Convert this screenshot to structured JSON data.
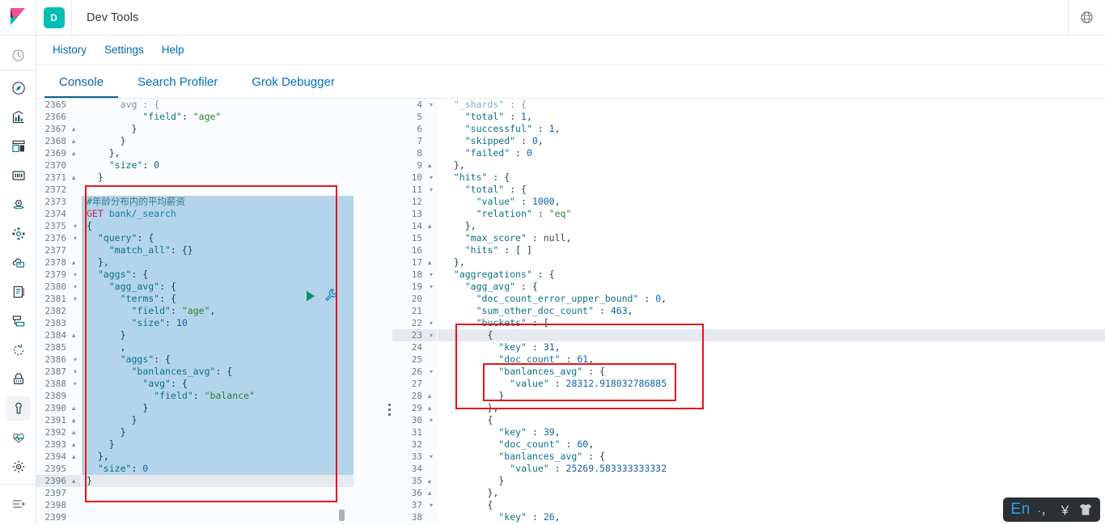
{
  "app": {
    "logo_icon": "kibana-logo",
    "badge_letter": "D",
    "title": "Dev Tools",
    "help_icon": "help-globe-icon"
  },
  "rail": {
    "top_items": [
      {
        "icon": "recently-viewed-clock-icon",
        "selected": false
      }
    ],
    "main_items": [
      {
        "icon": "discover-compass-icon",
        "selected": false
      },
      {
        "icon": "visualize-chart-icon",
        "selected": false
      },
      {
        "icon": "dashboard-grid-icon",
        "selected": false
      },
      {
        "icon": "canvas-presentation-icon",
        "selected": false
      },
      {
        "icon": "maps-globe-icon",
        "selected": false
      },
      {
        "icon": "machine-learning-nodes-icon",
        "selected": false
      },
      {
        "icon": "infrastructure-cloud-icon",
        "selected": false
      },
      {
        "icon": "logs-document-icon",
        "selected": false
      },
      {
        "icon": "apm-server-icon",
        "selected": false
      },
      {
        "icon": "uptime-refresh-icon",
        "selected": false
      },
      {
        "icon": "siem-lock-icon",
        "selected": false
      },
      {
        "icon": "dev-tools-wrench-icon",
        "selected": true
      },
      {
        "icon": "monitoring-heartbeat-icon",
        "selected": false
      },
      {
        "icon": "management-gear-icon",
        "selected": false
      }
    ],
    "bottom_items": [
      {
        "icon": "collapse-arrow-icon",
        "selected": false
      }
    ]
  },
  "menu": {
    "items": [
      {
        "label": "History"
      },
      {
        "label": "Settings"
      },
      {
        "label": "Help"
      }
    ]
  },
  "tabs": [
    {
      "label": "Console",
      "active": true
    },
    {
      "label": "Search Profiler",
      "active": false
    },
    {
      "label": "Grok Debugger",
      "active": false
    }
  ],
  "editor": {
    "play_icon": "run-request-play-icon",
    "wrench_icon": "request-options-wrench-icon",
    "first_line_number": 2365,
    "highlighted_line": 2396,
    "lines": [
      {
        "n": 2365,
        "fold": "",
        "sel": false,
        "text": "      avg : {",
        "clipped": true
      },
      {
        "n": 2366,
        "fold": "",
        "sel": false,
        "text": "          \"field\": \"age\""
      },
      {
        "n": 2367,
        "fold": "▲",
        "sel": false,
        "text": "        }"
      },
      {
        "n": 2368,
        "fold": "▲",
        "sel": false,
        "text": "      }"
      },
      {
        "n": 2369,
        "fold": "▲",
        "sel": false,
        "text": "    },"
      },
      {
        "n": 2370,
        "fold": "",
        "sel": false,
        "text": "    \"size\": 0"
      },
      {
        "n": 2371,
        "fold": "▲",
        "sel": false,
        "text": "  }"
      },
      {
        "n": 2372,
        "fold": "",
        "sel": false,
        "text": ""
      },
      {
        "n": 2373,
        "fold": "",
        "sel": true,
        "text": "#年龄分布内的平均薪资"
      },
      {
        "n": 2374,
        "fold": "",
        "sel": true,
        "text": "GET bank/_search"
      },
      {
        "n": 2375,
        "fold": "▾",
        "sel": true,
        "text": "{"
      },
      {
        "n": 2376,
        "fold": "▾",
        "sel": true,
        "text": "  \"query\": {"
      },
      {
        "n": 2377,
        "fold": "",
        "sel": true,
        "text": "    \"match_all\": {}"
      },
      {
        "n": 2378,
        "fold": "▲",
        "sel": true,
        "text": "  },"
      },
      {
        "n": 2379,
        "fold": "▾",
        "sel": true,
        "text": "  \"aggs\": {"
      },
      {
        "n": 2380,
        "fold": "▾",
        "sel": true,
        "text": "    \"agg_avg\": {"
      },
      {
        "n": 2381,
        "fold": "▾",
        "sel": true,
        "text": "      \"terms\": {"
      },
      {
        "n": 2382,
        "fold": "",
        "sel": true,
        "text": "        \"field\": \"age\","
      },
      {
        "n": 2383,
        "fold": "",
        "sel": true,
        "text": "        \"size\": 10"
      },
      {
        "n": 2384,
        "fold": "▲",
        "sel": true,
        "text": "      }"
      },
      {
        "n": 2385,
        "fold": "",
        "sel": true,
        "text": "      ,"
      },
      {
        "n": 2386,
        "fold": "▾",
        "sel": true,
        "text": "      \"aggs\": {"
      },
      {
        "n": 2387,
        "fold": "▾",
        "sel": true,
        "text": "        \"banlances_avg\": {"
      },
      {
        "n": 2388,
        "fold": "▾",
        "sel": true,
        "text": "          \"avg\": {"
      },
      {
        "n": 2389,
        "fold": "",
        "sel": true,
        "text": "            \"field\": \"balance\""
      },
      {
        "n": 2390,
        "fold": "▲",
        "sel": true,
        "text": "          }"
      },
      {
        "n": 2391,
        "fold": "▲",
        "sel": true,
        "text": "        }"
      },
      {
        "n": 2392,
        "fold": "▲",
        "sel": true,
        "text": "      }"
      },
      {
        "n": 2393,
        "fold": "▲",
        "sel": true,
        "text": "    }"
      },
      {
        "n": 2394,
        "fold": "▲",
        "sel": true,
        "text": "  },"
      },
      {
        "n": 2395,
        "fold": "",
        "sel": true,
        "text": "  \"size\": 0"
      },
      {
        "n": 2396,
        "fold": "▲",
        "sel": false,
        "text": "}"
      },
      {
        "n": 2397,
        "fold": "",
        "sel": false,
        "text": ""
      },
      {
        "n": 2398,
        "fold": "",
        "sel": false,
        "text": ""
      },
      {
        "n": 2399,
        "fold": "",
        "sel": false,
        "text": ""
      }
    ]
  },
  "response": {
    "first_line_number": 4,
    "highlighted_line": 23,
    "lines": [
      {
        "n": 4,
        "fold": "▾",
        "text": "  \"_shards\" : {",
        "clipped": true
      },
      {
        "n": 5,
        "fold": "",
        "text": "    \"total\" : 1,"
      },
      {
        "n": 6,
        "fold": "",
        "text": "    \"successful\" : 1,"
      },
      {
        "n": 7,
        "fold": "",
        "text": "    \"skipped\" : 0,"
      },
      {
        "n": 8,
        "fold": "",
        "text": "    \"failed\" : 0"
      },
      {
        "n": 9,
        "fold": "▲",
        "text": "  },"
      },
      {
        "n": 10,
        "fold": "▾",
        "text": "  \"hits\" : {"
      },
      {
        "n": 11,
        "fold": "▾",
        "text": "    \"total\" : {"
      },
      {
        "n": 12,
        "fold": "",
        "text": "      \"value\" : 1000,"
      },
      {
        "n": 13,
        "fold": "",
        "text": "      \"relation\" : \"eq\""
      },
      {
        "n": 14,
        "fold": "▲",
        "text": "    },"
      },
      {
        "n": 15,
        "fold": "",
        "text": "    \"max_score\" : null,"
      },
      {
        "n": 16,
        "fold": "",
        "text": "    \"hits\" : [ ]"
      },
      {
        "n": 17,
        "fold": "▲",
        "text": "  },"
      },
      {
        "n": 18,
        "fold": "▾",
        "text": "  \"aggregations\" : {"
      },
      {
        "n": 19,
        "fold": "▾",
        "text": "    \"agg_avg\" : {"
      },
      {
        "n": 20,
        "fold": "",
        "text": "      \"doc_count_error_upper_bound\" : 0,"
      },
      {
        "n": 21,
        "fold": "",
        "text": "      \"sum_other_doc_count\" : 463,"
      },
      {
        "n": 22,
        "fold": "▾",
        "text": "      \"buckets\" : ["
      },
      {
        "n": 23,
        "fold": "▾",
        "text": "        {"
      },
      {
        "n": 24,
        "fold": "",
        "text": "          \"key\" : 31,"
      },
      {
        "n": 25,
        "fold": "",
        "text": "          \"doc_count\" : 61,"
      },
      {
        "n": 26,
        "fold": "▾",
        "text": "          \"banlances_avg\" : {"
      },
      {
        "n": 27,
        "fold": "",
        "text": "            \"value\" : 28312.918032786885"
      },
      {
        "n": 28,
        "fold": "▲",
        "text": "          }"
      },
      {
        "n": 29,
        "fold": "▲",
        "text": "        },"
      },
      {
        "n": 30,
        "fold": "▾",
        "text": "        {"
      },
      {
        "n": 31,
        "fold": "",
        "text": "          \"key\" : 39,"
      },
      {
        "n": 32,
        "fold": "",
        "text": "          \"doc_count\" : 60,"
      },
      {
        "n": 33,
        "fold": "▾",
        "text": "          \"banlances_avg\" : {"
      },
      {
        "n": 34,
        "fold": "",
        "text": "            \"value\" : 25269.583333333332"
      },
      {
        "n": 35,
        "fold": "▲",
        "text": "          }"
      },
      {
        "n": 36,
        "fold": "▲",
        "text": "        },"
      },
      {
        "n": 37,
        "fold": "▾",
        "text": "        {"
      },
      {
        "n": 38,
        "fold": "",
        "text": "          \"key\" : 26,"
      }
    ]
  },
  "annotations": {
    "boxes": [
      {
        "name": "request-highlight-box"
      },
      {
        "name": "response-bucket-highlight-box"
      },
      {
        "name": "response-avg-value-highlight-box"
      }
    ],
    "color": "#e8121b"
  },
  "ime": {
    "language": "En",
    "punctuation": "·，",
    "currency": "￥",
    "skin_icon": "ime-skin-shirt-icon"
  },
  "colors": {
    "accent_teal": "#00bfb3",
    "link_blue": "#006bb4",
    "tab_active": "#0a5f9c",
    "selection_bg": "#b3d4ea",
    "annotation_red": "#e8121b"
  }
}
